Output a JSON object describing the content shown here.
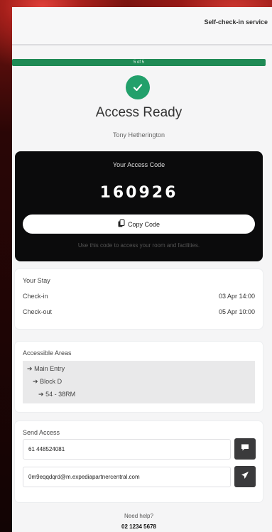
{
  "header": {
    "title": "Self-check-in service"
  },
  "progress": {
    "label": "5 of 5",
    "fraction": 1.0
  },
  "status": {
    "title": "Access Ready",
    "guest": "Tony Hetherington"
  },
  "access": {
    "label": "Your Access Code",
    "code": "160926",
    "copy_label": "Copy Code",
    "hint": "Use this code to access your room and facilities."
  },
  "stay": {
    "title": "Your Stay",
    "checkin_label": "Check-in",
    "checkin_value": "03 Apr 14:00",
    "checkout_label": "Check-out",
    "checkout_value": "05 Apr 10:00"
  },
  "areas": {
    "title": "Accessible Areas",
    "items": [
      "Main Entry",
      "Block D",
      "54 - 38RM"
    ]
  },
  "send": {
    "title": "Send Access",
    "phone": "61 448524081",
    "email": "0m9eqqdqrd@m.expediapartnercentral.com"
  },
  "help": {
    "label": "Need help?",
    "phone": "02 1234 5678"
  },
  "colors": {
    "accent_green": "#22a06b",
    "progress_green": "#1f8a55",
    "dark": "#0b0b0c"
  },
  "icons": [
    "check-icon",
    "copy-icon",
    "arrow-right-icon",
    "sms-icon",
    "send-icon"
  ]
}
